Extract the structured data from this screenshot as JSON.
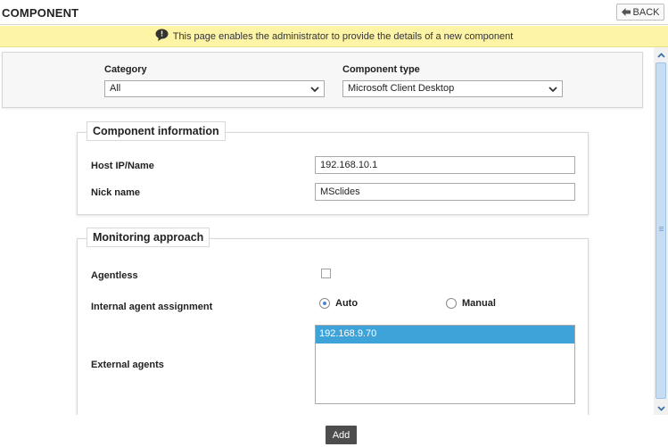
{
  "header": {
    "title": "COMPONENT",
    "back_label": "BACK"
  },
  "info_bar": {
    "message": "This page enables the administrator to provide the details of a new component"
  },
  "filters": {
    "category_label": "Category",
    "category_value": "All",
    "component_type_label": "Component type",
    "component_type_value": "Microsoft Client Desktop"
  },
  "component_info": {
    "legend": "Component information",
    "host_label": "Host IP/Name",
    "host_value": "192.168.10.1",
    "nick_label": "Nick name",
    "nick_value": "MSclides"
  },
  "monitoring": {
    "legend": "Monitoring approach",
    "agentless_label": "Agentless",
    "agentless_checked": false,
    "internal_label": "Internal agent assignment",
    "auto_label": "Auto",
    "manual_label": "Manual",
    "selected_assignment": "Auto",
    "external_label": "External agents",
    "external_agents": [
      "192.168.9.70"
    ]
  },
  "actions": {
    "add_label": "Add"
  },
  "colors": {
    "info_bar_bg": "#fdf4a6",
    "list_selected": "#3ea3d8",
    "add_button_bg": "#4d4d4d",
    "scroll_thumb": "#c6ddf3"
  }
}
